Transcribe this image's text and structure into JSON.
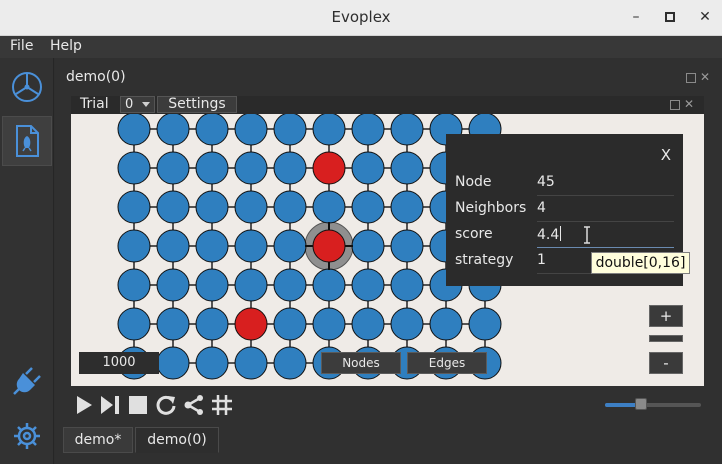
{
  "window": {
    "title": "Evoplex"
  },
  "menu": {
    "file": "File",
    "help": "Help"
  },
  "experiment": {
    "title": "demo(0)",
    "trial_label": "Trial",
    "trial_value": "0",
    "settings_tab": "Settings"
  },
  "grid": {
    "rows": 7,
    "cols": 10,
    "node_color": "#2f7fbf",
    "highlight_color": "#d81f1f",
    "red_nodes": [
      [
        1,
        5
      ],
      [
        3,
        5
      ],
      [
        5,
        3
      ]
    ],
    "selected_node": [
      3,
      5
    ]
  },
  "inspector": {
    "close": "X",
    "rows": [
      {
        "key": "Node",
        "value": "45"
      },
      {
        "key": "Neighbors",
        "value": "4"
      },
      {
        "key": "score",
        "value": "4.4"
      },
      {
        "key": "strategy",
        "value": "1"
      }
    ],
    "tooltip": "double[0,16]"
  },
  "canvas_controls": {
    "steps": "1000",
    "nodes_btn": "Nodes",
    "edges_btn": "Edges",
    "zoom_in": "+",
    "zoom_out": "-"
  },
  "toolbar": {
    "speed_fraction": 0.38
  },
  "bottom_tabs": [
    {
      "label": "demo*"
    },
    {
      "label": "demo(0)"
    }
  ],
  "colors": {
    "accent": "#3d7fc4",
    "canvas_bg": "#efebe7",
    "panel_bg": "#2b2b2b"
  }
}
